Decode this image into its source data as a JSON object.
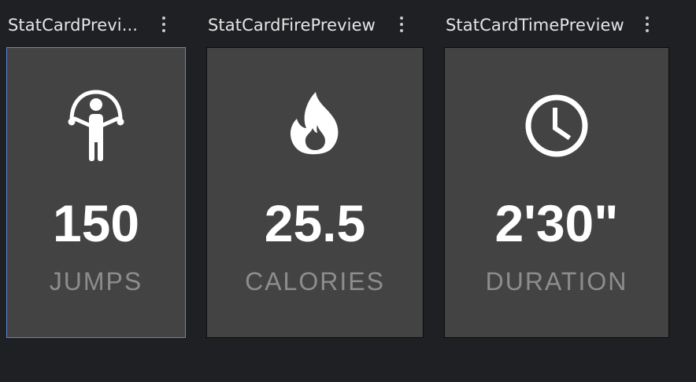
{
  "previews": [
    {
      "title": "StatCardPrevi...",
      "icon": "jump-rope-icon",
      "value": "150",
      "label": "JUMPS",
      "selected": true
    },
    {
      "title": "StatCardFirePreview",
      "icon": "fire-icon",
      "value": "25.5",
      "label": "CALORIES",
      "selected": false
    },
    {
      "title": "StatCardTimePreview",
      "icon": "clock-icon",
      "value": "2'30\"",
      "label": "DURATION",
      "selected": false
    }
  ],
  "colors": {
    "background": "#1f2023",
    "card": "#434343",
    "selection_border": "#5a86d8",
    "value_text": "#ffffff",
    "label_text": "#8d8d8d"
  }
}
